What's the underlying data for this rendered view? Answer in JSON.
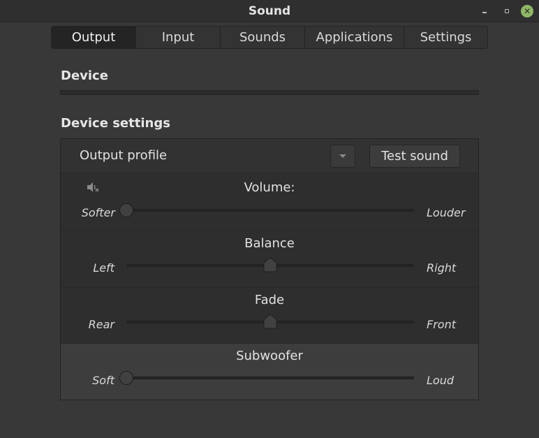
{
  "window": {
    "title": "Sound"
  },
  "tabs": [
    {
      "label": "Output",
      "active": true
    },
    {
      "label": "Input",
      "active": false
    },
    {
      "label": "Sounds",
      "active": false
    },
    {
      "label": "Applications",
      "active": false
    },
    {
      "label": "Settings",
      "active": false
    }
  ],
  "sections": {
    "device": "Device",
    "device_settings": "Device settings"
  },
  "output_profile": {
    "label": "Output profile",
    "selected": ""
  },
  "test_sound_label": "Test sound",
  "sliders": {
    "volume": {
      "title": "Volume:",
      "left": "Softer",
      "right": "Louder",
      "value": 0.0,
      "muted": true
    },
    "balance": {
      "title": "Balance",
      "left": "Left",
      "right": "Right",
      "value": 0.5
    },
    "fade": {
      "title": "Fade",
      "left": "Rear",
      "right": "Front",
      "value": 0.5
    },
    "subwoofer": {
      "title": "Subwoofer",
      "left": "Soft",
      "right": "Loud",
      "value": 0.0
    }
  },
  "colors": {
    "close_button": "#8fb765",
    "active_tab": "#242424"
  },
  "icons": {
    "volume": "speaker-muted-icon",
    "dropdown": "chevron-down-icon"
  }
}
